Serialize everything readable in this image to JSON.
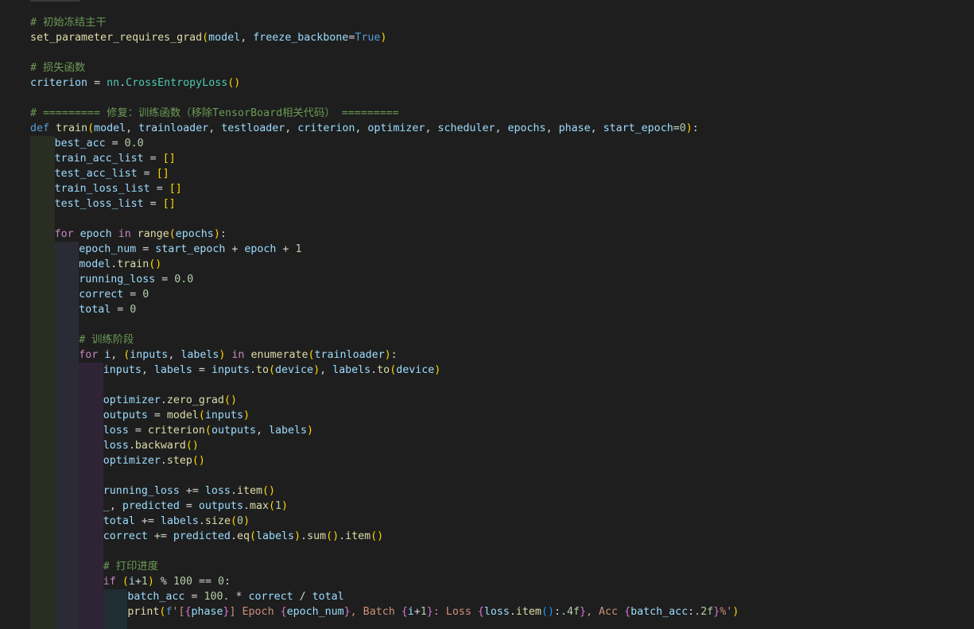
{
  "editor": {
    "lines": [
      {
        "indent": 0,
        "tokens": [
          [
            "c-comment",
            "# 初始冻结主干"
          ]
        ]
      },
      {
        "indent": 0,
        "tokens": [
          [
            "c-func",
            "set_parameter_requires_grad"
          ],
          [
            "c-paren1",
            "("
          ],
          [
            "c-var",
            "model"
          ],
          [
            "c-plain",
            ", "
          ],
          [
            "c-var",
            "freeze_backbone"
          ],
          [
            "c-plain",
            "="
          ],
          [
            "c-const",
            "True"
          ],
          [
            "c-paren1",
            ")"
          ]
        ]
      },
      {
        "indent": 0,
        "tokens": []
      },
      {
        "indent": 0,
        "tokens": [
          [
            "c-comment",
            "# 损失函数"
          ]
        ]
      },
      {
        "indent": 0,
        "tokens": [
          [
            "c-var",
            "criterion"
          ],
          [
            "c-plain",
            " = "
          ],
          [
            "c-class",
            "nn"
          ],
          [
            "c-plain",
            "."
          ],
          [
            "c-class",
            "CrossEntropyLoss"
          ],
          [
            "c-paren1",
            "()"
          ]
        ]
      },
      {
        "indent": 0,
        "tokens": []
      },
      {
        "indent": 0,
        "tokens": [
          [
            "c-comment",
            "# ========= 修复：训练函数（移除TensorBoard相关代码） ========="
          ]
        ]
      },
      {
        "indent": 0,
        "tokens": [
          [
            "c-def",
            "def"
          ],
          [
            "c-plain",
            " "
          ],
          [
            "c-func",
            "train"
          ],
          [
            "c-paren1",
            "("
          ],
          [
            "c-var",
            "model"
          ],
          [
            "c-plain",
            ", "
          ],
          [
            "c-var",
            "trainloader"
          ],
          [
            "c-plain",
            ", "
          ],
          [
            "c-var",
            "testloader"
          ],
          [
            "c-plain",
            ", "
          ],
          [
            "c-var",
            "criterion"
          ],
          [
            "c-plain",
            ", "
          ],
          [
            "c-var",
            "optimizer"
          ],
          [
            "c-plain",
            ", "
          ],
          [
            "c-var",
            "scheduler"
          ],
          [
            "c-plain",
            ", "
          ],
          [
            "c-var",
            "epochs"
          ],
          [
            "c-plain",
            ", "
          ],
          [
            "c-var",
            "phase"
          ],
          [
            "c-plain",
            ", "
          ],
          [
            "c-var",
            "start_epoch"
          ],
          [
            "c-plain",
            "="
          ],
          [
            "c-num",
            "0"
          ],
          [
            "c-paren1",
            ")"
          ],
          [
            "c-plain",
            ":"
          ]
        ]
      },
      {
        "indent": 1,
        "tokens": [
          [
            "c-var",
            "best_acc"
          ],
          [
            "c-plain",
            " = "
          ],
          [
            "c-num",
            "0.0"
          ]
        ]
      },
      {
        "indent": 1,
        "tokens": [
          [
            "c-var",
            "train_acc_list"
          ],
          [
            "c-plain",
            " = "
          ],
          [
            "c-paren1",
            "[]"
          ]
        ]
      },
      {
        "indent": 1,
        "tokens": [
          [
            "c-var",
            "test_acc_list"
          ],
          [
            "c-plain",
            " = "
          ],
          [
            "c-paren1",
            "[]"
          ]
        ]
      },
      {
        "indent": 1,
        "tokens": [
          [
            "c-var",
            "train_loss_list"
          ],
          [
            "c-plain",
            " = "
          ],
          [
            "c-paren1",
            "[]"
          ]
        ]
      },
      {
        "indent": 1,
        "tokens": [
          [
            "c-var",
            "test_loss_list"
          ],
          [
            "c-plain",
            " = "
          ],
          [
            "c-paren1",
            "[]"
          ]
        ]
      },
      {
        "indent": 1,
        "tokens": []
      },
      {
        "indent": 1,
        "tokens": [
          [
            "c-keyword",
            "for"
          ],
          [
            "c-plain",
            " "
          ],
          [
            "c-var",
            "epoch"
          ],
          [
            "c-plain",
            " "
          ],
          [
            "c-keyword",
            "in"
          ],
          [
            "c-plain",
            " "
          ],
          [
            "c-func",
            "range"
          ],
          [
            "c-paren1",
            "("
          ],
          [
            "c-var",
            "epochs"
          ],
          [
            "c-paren1",
            ")"
          ],
          [
            "c-plain",
            ":"
          ]
        ]
      },
      {
        "indent": 2,
        "tokens": [
          [
            "c-var",
            "epoch_num"
          ],
          [
            "c-plain",
            " = "
          ],
          [
            "c-var",
            "start_epoch"
          ],
          [
            "c-plain",
            " + "
          ],
          [
            "c-var",
            "epoch"
          ],
          [
            "c-plain",
            " + "
          ],
          [
            "c-num",
            "1"
          ]
        ]
      },
      {
        "indent": 2,
        "tokens": [
          [
            "c-var",
            "model"
          ],
          [
            "c-plain",
            "."
          ],
          [
            "c-func",
            "train"
          ],
          [
            "c-paren1",
            "()"
          ]
        ]
      },
      {
        "indent": 2,
        "tokens": [
          [
            "c-var",
            "running_loss"
          ],
          [
            "c-plain",
            " = "
          ],
          [
            "c-num",
            "0.0"
          ]
        ]
      },
      {
        "indent": 2,
        "tokens": [
          [
            "c-var",
            "correct"
          ],
          [
            "c-plain",
            " = "
          ],
          [
            "c-num",
            "0"
          ]
        ]
      },
      {
        "indent": 2,
        "tokens": [
          [
            "c-var",
            "total"
          ],
          [
            "c-plain",
            " = "
          ],
          [
            "c-num",
            "0"
          ]
        ]
      },
      {
        "indent": 2,
        "tokens": []
      },
      {
        "indent": 2,
        "tokens": [
          [
            "c-comment",
            "# 训练阶段"
          ]
        ]
      },
      {
        "indent": 2,
        "tokens": [
          [
            "c-keyword",
            "for"
          ],
          [
            "c-plain",
            " "
          ],
          [
            "c-var",
            "i"
          ],
          [
            "c-plain",
            ", "
          ],
          [
            "c-paren1",
            "("
          ],
          [
            "c-var",
            "inputs"
          ],
          [
            "c-plain",
            ", "
          ],
          [
            "c-var",
            "labels"
          ],
          [
            "c-paren1",
            ")"
          ],
          [
            "c-plain",
            " "
          ],
          [
            "c-keyword",
            "in"
          ],
          [
            "c-plain",
            " "
          ],
          [
            "c-func",
            "enumerate"
          ],
          [
            "c-paren1",
            "("
          ],
          [
            "c-var",
            "trainloader"
          ],
          [
            "c-paren1",
            ")"
          ],
          [
            "c-plain",
            ":"
          ]
        ]
      },
      {
        "indent": 3,
        "tokens": [
          [
            "c-var",
            "inputs"
          ],
          [
            "c-plain",
            ", "
          ],
          [
            "c-var",
            "labels"
          ],
          [
            "c-plain",
            " = "
          ],
          [
            "c-var",
            "inputs"
          ],
          [
            "c-plain",
            "."
          ],
          [
            "c-func",
            "to"
          ],
          [
            "c-paren1",
            "("
          ],
          [
            "c-var",
            "device"
          ],
          [
            "c-paren1",
            ")"
          ],
          [
            "c-plain",
            ", "
          ],
          [
            "c-var",
            "labels"
          ],
          [
            "c-plain",
            "."
          ],
          [
            "c-func",
            "to"
          ],
          [
            "c-paren1",
            "("
          ],
          [
            "c-var",
            "device"
          ],
          [
            "c-paren1",
            ")"
          ]
        ]
      },
      {
        "indent": 3,
        "tokens": []
      },
      {
        "indent": 3,
        "tokens": [
          [
            "c-var",
            "optimizer"
          ],
          [
            "c-plain",
            "."
          ],
          [
            "c-func",
            "zero_grad"
          ],
          [
            "c-paren1",
            "()"
          ]
        ]
      },
      {
        "indent": 3,
        "tokens": [
          [
            "c-var",
            "outputs"
          ],
          [
            "c-plain",
            " = "
          ],
          [
            "c-func",
            "model"
          ],
          [
            "c-paren1",
            "("
          ],
          [
            "c-var",
            "inputs"
          ],
          [
            "c-paren1",
            ")"
          ]
        ]
      },
      {
        "indent": 3,
        "tokens": [
          [
            "c-var",
            "loss"
          ],
          [
            "c-plain",
            " = "
          ],
          [
            "c-func",
            "criterion"
          ],
          [
            "c-paren1",
            "("
          ],
          [
            "c-var",
            "outputs"
          ],
          [
            "c-plain",
            ", "
          ],
          [
            "c-var",
            "labels"
          ],
          [
            "c-paren1",
            ")"
          ]
        ]
      },
      {
        "indent": 3,
        "tokens": [
          [
            "c-var",
            "loss"
          ],
          [
            "c-plain",
            "."
          ],
          [
            "c-func",
            "backward"
          ],
          [
            "c-paren1",
            "()"
          ]
        ]
      },
      {
        "indent": 3,
        "tokens": [
          [
            "c-var",
            "optimizer"
          ],
          [
            "c-plain",
            "."
          ],
          [
            "c-func",
            "step"
          ],
          [
            "c-paren1",
            "()"
          ]
        ]
      },
      {
        "indent": 3,
        "tokens": []
      },
      {
        "indent": 3,
        "tokens": [
          [
            "c-var",
            "running_loss"
          ],
          [
            "c-plain",
            " += "
          ],
          [
            "c-var",
            "loss"
          ],
          [
            "c-plain",
            "."
          ],
          [
            "c-func",
            "item"
          ],
          [
            "c-paren1",
            "()"
          ]
        ]
      },
      {
        "indent": 3,
        "tokens": [
          [
            "c-var",
            "_"
          ],
          [
            "c-plain",
            ", "
          ],
          [
            "c-var",
            "predicted"
          ],
          [
            "c-plain",
            " = "
          ],
          [
            "c-var",
            "outputs"
          ],
          [
            "c-plain",
            "."
          ],
          [
            "c-func",
            "max"
          ],
          [
            "c-paren1",
            "("
          ],
          [
            "c-num",
            "1"
          ],
          [
            "c-paren1",
            ")"
          ]
        ]
      },
      {
        "indent": 3,
        "tokens": [
          [
            "c-var",
            "total"
          ],
          [
            "c-plain",
            " += "
          ],
          [
            "c-var",
            "labels"
          ],
          [
            "c-plain",
            "."
          ],
          [
            "c-func",
            "size"
          ],
          [
            "c-paren1",
            "("
          ],
          [
            "c-num",
            "0"
          ],
          [
            "c-paren1",
            ")"
          ]
        ]
      },
      {
        "indent": 3,
        "tokens": [
          [
            "c-var",
            "correct"
          ],
          [
            "c-plain",
            " += "
          ],
          [
            "c-var",
            "predicted"
          ],
          [
            "c-plain",
            "."
          ],
          [
            "c-func",
            "eq"
          ],
          [
            "c-paren1",
            "("
          ],
          [
            "c-var",
            "labels"
          ],
          [
            "c-paren1",
            ")"
          ],
          [
            "c-plain",
            "."
          ],
          [
            "c-func",
            "sum"
          ],
          [
            "c-paren1",
            "()"
          ],
          [
            "c-plain",
            "."
          ],
          [
            "c-func",
            "item"
          ],
          [
            "c-paren1",
            "()"
          ]
        ]
      },
      {
        "indent": 3,
        "tokens": []
      },
      {
        "indent": 3,
        "tokens": [
          [
            "c-comment",
            "# 打印进度"
          ]
        ]
      },
      {
        "indent": 3,
        "tokens": [
          [
            "c-keyword",
            "if"
          ],
          [
            "c-plain",
            " "
          ],
          [
            "c-paren1",
            "("
          ],
          [
            "c-var",
            "i"
          ],
          [
            "c-plain",
            "+"
          ],
          [
            "c-num",
            "1"
          ],
          [
            "c-paren1",
            ")"
          ],
          [
            "c-plain",
            " % "
          ],
          [
            "c-num",
            "100"
          ],
          [
            "c-plain",
            " == "
          ],
          [
            "c-num",
            "0"
          ],
          [
            "c-plain",
            ":"
          ]
        ]
      },
      {
        "indent": 4,
        "tokens": [
          [
            "c-var",
            "batch_acc"
          ],
          [
            "c-plain",
            " = "
          ],
          [
            "c-num",
            "100."
          ],
          [
            "c-plain",
            " * "
          ],
          [
            "c-var",
            "correct"
          ],
          [
            "c-plain",
            " / "
          ],
          [
            "c-var",
            "total"
          ]
        ]
      },
      {
        "indent": 4,
        "tokens": [
          [
            "c-func",
            "print"
          ],
          [
            "c-paren1",
            "("
          ],
          [
            "c-fkw",
            "f"
          ],
          [
            "c-str",
            "'["
          ],
          [
            "c-paren2",
            "{"
          ],
          [
            "c-var",
            "phase"
          ],
          [
            "c-paren2",
            "}"
          ],
          [
            "c-str",
            "] Epoch "
          ],
          [
            "c-paren2",
            "{"
          ],
          [
            "c-var",
            "epoch_num"
          ],
          [
            "c-paren2",
            "}"
          ],
          [
            "c-str",
            ", Batch "
          ],
          [
            "c-paren2",
            "{"
          ],
          [
            "c-var",
            "i"
          ],
          [
            "c-plain",
            "+"
          ],
          [
            "c-num",
            "1"
          ],
          [
            "c-paren2",
            "}"
          ],
          [
            "c-str",
            ": Loss "
          ],
          [
            "c-paren2",
            "{"
          ],
          [
            "c-var",
            "loss"
          ],
          [
            "c-plain",
            "."
          ],
          [
            "c-func",
            "item"
          ],
          [
            "c-paren3",
            "()"
          ],
          [
            "c-plain",
            ":"
          ],
          [
            "c-num",
            ".4f"
          ],
          [
            "c-paren2",
            "}"
          ],
          [
            "c-str",
            ", Acc "
          ],
          [
            "c-paren2",
            "{"
          ],
          [
            "c-var",
            "batch_acc"
          ],
          [
            "c-plain",
            ":"
          ],
          [
            "c-num",
            ".2f"
          ],
          [
            "c-paren2",
            "}"
          ],
          [
            "c-str",
            "%'"
          ],
          [
            "c-paren1",
            ")"
          ]
        ]
      }
    ]
  },
  "theme": {
    "background": "#1e1e1e",
    "guide_colors": [
      "#2a2d22",
      "#2b2b36",
      "#2f2435",
      "#1f2e33"
    ]
  }
}
